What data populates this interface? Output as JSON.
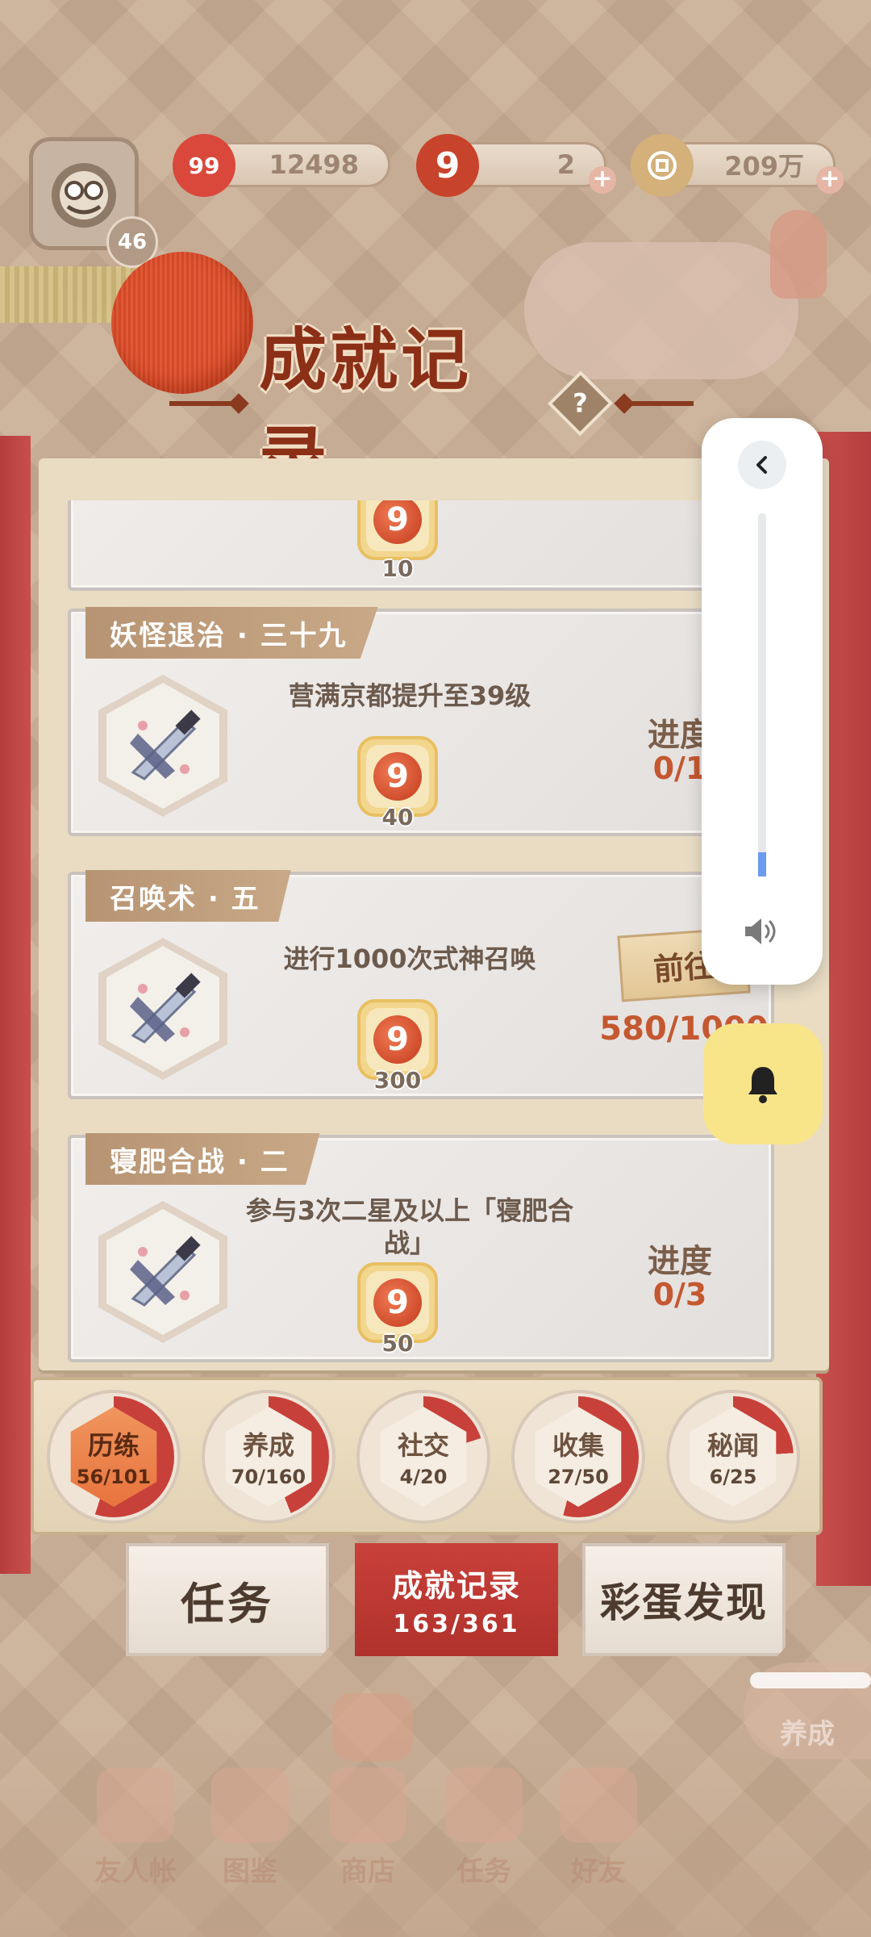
{
  "header": {
    "player_level": "46",
    "resources": [
      {
        "name": "jade",
        "icon_label": "99",
        "value": "12498",
        "color": "#d9483b"
      },
      {
        "name": "summon-ticket",
        "icon_label": "9",
        "value": "2",
        "color": "#c8432b"
      },
      {
        "name": "coin",
        "icon_label": "",
        "value": "209万",
        "color": "#d4b07a"
      }
    ]
  },
  "title": {
    "text": "成就记录",
    "help_label": "?"
  },
  "achievements": [
    {
      "title": "",
      "description": "",
      "reward_icon": "9",
      "reward_count": "10",
      "progress_label": "",
      "progress_value": "",
      "partial": true
    },
    {
      "title": "妖怪退治 · 三十九",
      "description": "营满京都提升至39级",
      "reward_icon": "9",
      "reward_count": "40",
      "progress_label": "进度",
      "progress_value": "0/1"
    },
    {
      "title": "召唤术 · 五",
      "description": "进行1000次式神召唤",
      "reward_icon": "9",
      "reward_count": "300",
      "go_label": "前往",
      "progress_value": "580/1000"
    },
    {
      "title": "寝肥合战 · 二",
      "description": "参与3次二星及以上「寝肥合战」",
      "reward_icon": "9",
      "reward_count": "50",
      "progress_label": "进度",
      "progress_value": "0/3"
    }
  ],
  "categories": [
    {
      "name": "历练",
      "count": "56/101",
      "progress": 0.55,
      "active": true
    },
    {
      "name": "养成",
      "count": "70/160",
      "progress": 0.44,
      "active": false
    },
    {
      "name": "社交",
      "count": "4/20",
      "progress": 0.2,
      "active": false
    },
    {
      "name": "收集",
      "count": "27/50",
      "progress": 0.54,
      "active": false
    },
    {
      "name": "秘闻",
      "count": "6/25",
      "progress": 0.24,
      "active": false
    }
  ],
  "tabs": {
    "tasks": "任务",
    "achievements": "成就记录",
    "achievements_count": "163/361",
    "easter_eggs": "彩蛋发现"
  },
  "side_chip": "养成",
  "bottom_nav": [
    {
      "label": "友人帐",
      "icon": "book-icon"
    },
    {
      "label": "图鉴",
      "icon": "eye-scroll-icon"
    },
    {
      "label": "商店",
      "icon": "cat-shop-icon"
    },
    {
      "label": "任务",
      "icon": "task-icon"
    },
    {
      "label": "好友",
      "icon": "friends-icon"
    }
  ],
  "colors": {
    "accent_red": "#b0312c",
    "progress_orange": "#c45830",
    "volume_fill": "#6b9bf0",
    "bell_bg": "#f8e58a"
  }
}
